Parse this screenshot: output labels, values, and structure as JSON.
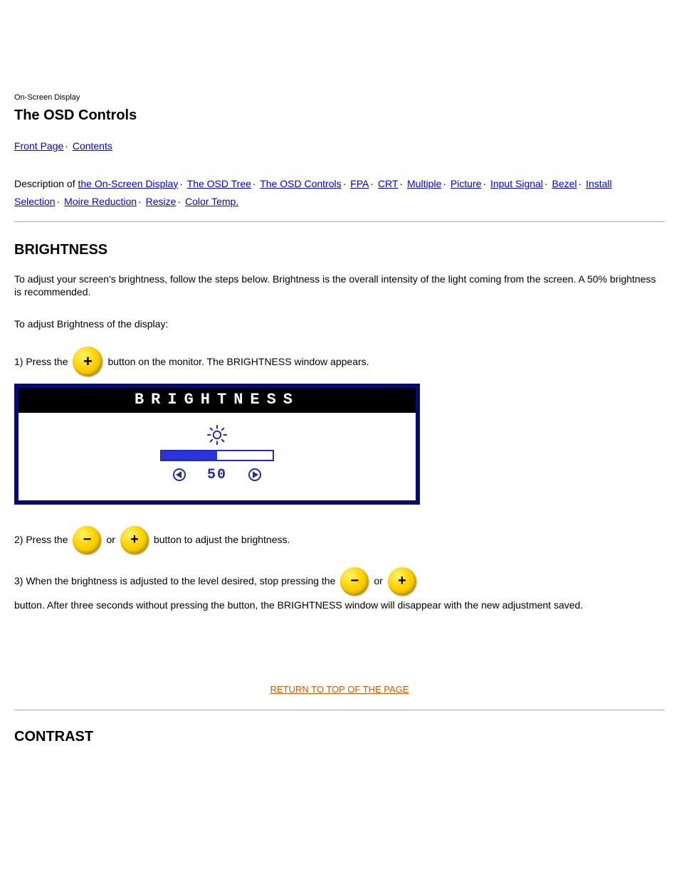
{
  "subtitle": "On-Screen Display",
  "title": "The OSD Controls",
  "nav1": {
    "front": "Front Page",
    "contents": "Contents"
  },
  "nav2_prefix": "Description of ",
  "nav2": {
    "osd": "the On-Screen Display",
    "tree": "The OSD Tree",
    "controls": "The OSD Controls",
    "fpa": "FPA",
    "crt": "CRT",
    "mp": "Multiple",
    "picture": "Picture",
    "inputs": "Input Signal",
    "bezel": "Bezel",
    "install": "Install"
  },
  "nav3": {
    "selection": "Selection",
    "moire": "Moire Reduction",
    "resize": "Resize",
    "color": "Color Temp."
  },
  "brightness": {
    "heading": "BRIGHTNESS",
    "desc": "To adjust your screen's brightness, follow the steps below. Brightness is the overall intensity of the light coming from the screen. A 50% brightness is recommended.",
    "adjust": "To adjust Brightness of the display:",
    "step1_pre": "1) Press the ",
    "step1_post": " button on the monitor. The BRIGHTNESS window appears.",
    "osd_title": "BRIGHTNESS",
    "value": "50",
    "progress_pct": 50,
    "step2_pre": "2) Press the ",
    "step2_mid": " or ",
    "step2_post": " button to adjust the brightness.",
    "step3a_pre": "3) When the brightness is adjusted to the level desired, stop pressing the ",
    "step3a_mid": " or ",
    "step3b": "  button. After three seconds without pressing the button, the BRIGHTNESS window will disappear with the new adjustment saved."
  },
  "return": "RETURN TO TOP OF THE PAGE",
  "contrast": {
    "heading": "CONTRAST"
  },
  "icons": {
    "plus": "+",
    "minus": "−"
  }
}
